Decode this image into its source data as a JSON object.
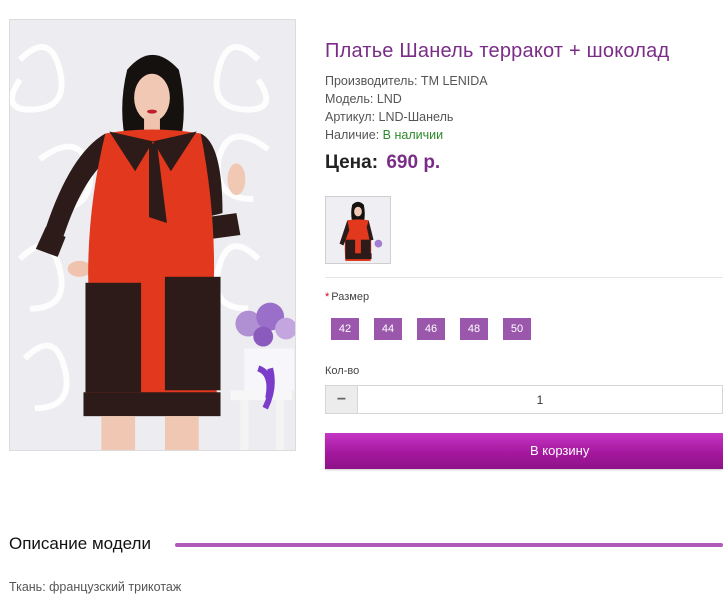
{
  "product": {
    "title": "Платье Шанель терракот + шоколад",
    "manufacturer": "Производитель: TM LENIDA",
    "model": "Модель: LND",
    "sku": "Артикул: LND-Шанель",
    "availability_label": "Наличие:",
    "availability_value": "В наличии",
    "price_label": "Цена:",
    "price": "690 р."
  },
  "options": {
    "size_required_mark": "*",
    "size_label": "Размер",
    "sizes": [
      "42",
      "44",
      "46",
      "48",
      "50"
    ],
    "qty_label": "Кол-во",
    "qty_minus": "−",
    "qty_value": "1"
  },
  "cart": {
    "button_label": "В корзину"
  },
  "description": {
    "heading": "Описание модели",
    "fabric": "Ткань: французский трикотаж"
  },
  "colors": {
    "title": "#7a2d87",
    "accent": "#9a57ac",
    "cart_button": "#a4189e",
    "in_stock": "#2c8a2c",
    "dress_terracotta": "#e2381e",
    "dress_chocolate": "#2c1b18"
  },
  "icons": {
    "qty_decrease": "minus-icon",
    "required": "asterisk-icon"
  }
}
